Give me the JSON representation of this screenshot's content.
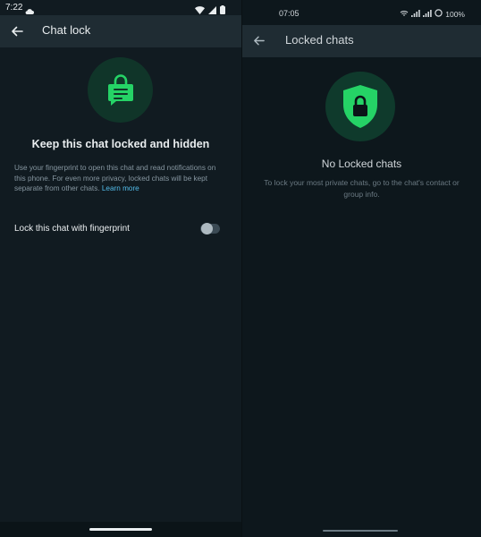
{
  "left": {
    "status_time": "7:22",
    "appbar_title": "Chat lock",
    "heading": "Keep this chat locked and hidden",
    "description": "Use your fingerprint to open this chat and read notifications on this phone. For even more privacy, locked chats will be kept separate from other chats.",
    "learn_more": "Learn more",
    "lock_label": "Lock this chat with fingerprint",
    "toggle_on": false
  },
  "right": {
    "status_time": "07:05",
    "battery": "100%",
    "appbar_title": "Locked chats",
    "heading": "No Locked chats",
    "description": "To lock your most private chats, go to the chat's contact or group info."
  },
  "colors": {
    "accent": "#25d366",
    "link": "#53bdeb",
    "header_bg": "#1f2c33",
    "panel_bg": "#111b21"
  },
  "icons": [
    "back-arrow-icon",
    "cloud-icon",
    "wifi-icon",
    "signal-icon",
    "battery-icon",
    "chat-lock-icon",
    "shield-lock-icon"
  ]
}
